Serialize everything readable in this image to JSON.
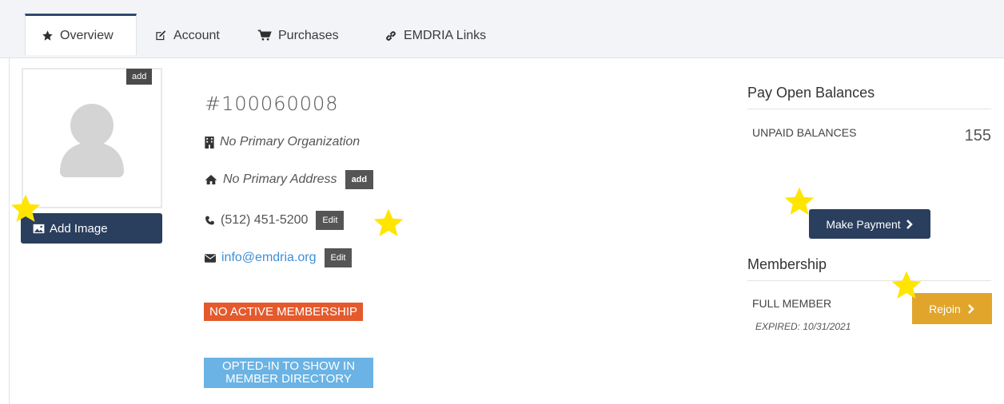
{
  "tabs": [
    {
      "label": "Overview",
      "icon": "star-icon",
      "active": true
    },
    {
      "label": "Account",
      "icon": "edit-icon"
    },
    {
      "label": "Purchases",
      "icon": "cart-icon"
    },
    {
      "label": "EMDRIA Links",
      "icon": "link-icon"
    }
  ],
  "profile": {
    "photo_add_label": "add",
    "add_image_label": "Add Image",
    "member_id": "#100060008",
    "organization": "No Primary Organization",
    "address": "No Primary Address",
    "address_add_label": "add",
    "phone": "(512) 451-5200",
    "phone_edit_label": "Edit",
    "email": "info@emdria.org",
    "email_edit_label": "Edit",
    "membership_status": "NO ACTIVE MEMBERSHIP",
    "directory_line1": "OPTED-IN TO SHOW IN",
    "directory_line2": "MEMBER DIRECTORY"
  },
  "balances": {
    "title": "Pay Open Balances",
    "label": "UNPAID BALANCES",
    "value": "155",
    "pay_button": "Make Payment"
  },
  "membership": {
    "title": "Membership",
    "type": "FULL MEMBER",
    "expired": "EXPIRED: 10/31/2021",
    "rejoin_button": "Rejoin"
  },
  "colors": {
    "navy": "#2a3e5d",
    "orange": "#e2a52c",
    "red_badge": "#e45a2c",
    "blue_badge": "#6ab3e4",
    "star": "#ffe500"
  }
}
